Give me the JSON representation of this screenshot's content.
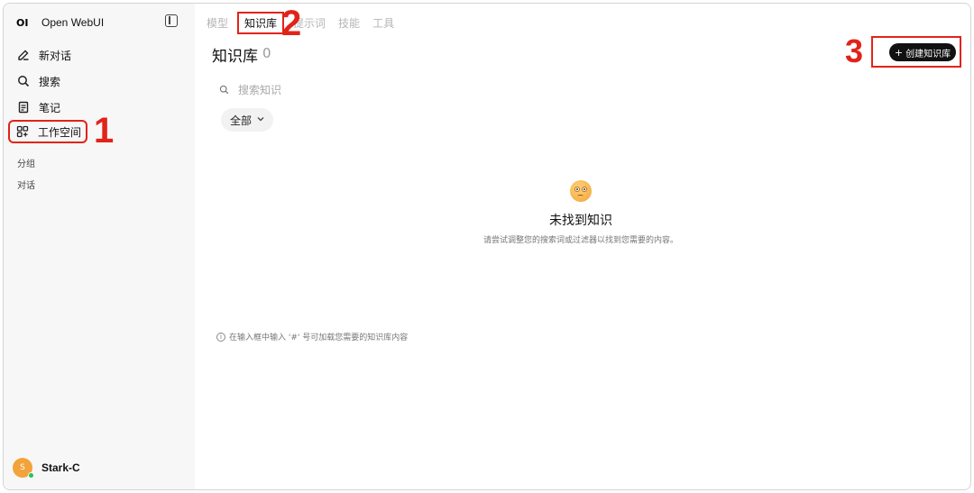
{
  "app": {
    "logo_text": "OI",
    "name": "Open WebUI"
  },
  "sidebar": {
    "items": [
      {
        "label": "新对话",
        "icon": "edit-icon"
      },
      {
        "label": "搜索",
        "icon": "search-icon"
      },
      {
        "label": "笔记",
        "icon": "notes-icon"
      },
      {
        "label": "工作空间",
        "icon": "workspace-icon"
      }
    ],
    "sections": [
      {
        "label": "分组"
      },
      {
        "label": "对话"
      }
    ],
    "user": {
      "initial": "S",
      "name": "Stark-C",
      "status_color": "#22c55e"
    }
  },
  "tabs": [
    {
      "label": "模型"
    },
    {
      "label": "知识库",
      "active": true
    },
    {
      "label": "提示词"
    },
    {
      "label": "技能"
    },
    {
      "label": "工具"
    }
  ],
  "page": {
    "title": "知识库",
    "count": "0"
  },
  "toolbar": {
    "create_label": "创建知识库",
    "create_icon": "plus-icon"
  },
  "search": {
    "placeholder": "搜索知识"
  },
  "filter": {
    "label": "全部"
  },
  "empty": {
    "title": "未找到知识",
    "description": "请尝试调整您的搜索词或过滤器以找到您需要的内容。"
  },
  "hint": {
    "text": "在输入框中输入 '#' 号可加载您需要的知识库内容"
  },
  "annotations": {
    "one": "1",
    "two": "2",
    "three": "3",
    "color": "#e2231a"
  }
}
